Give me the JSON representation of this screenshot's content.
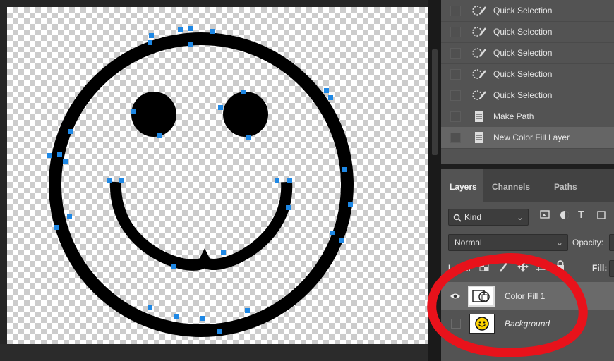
{
  "history": {
    "items": [
      {
        "label": "Quick Selection",
        "icon": "quick-selection-brush-icon",
        "selected": false
      },
      {
        "label": "Quick Selection",
        "icon": "quick-selection-brush-icon",
        "selected": false
      },
      {
        "label": "Quick Selection",
        "icon": "quick-selection-brush-icon",
        "selected": false
      },
      {
        "label": "Quick Selection",
        "icon": "quick-selection-brush-icon",
        "selected": false
      },
      {
        "label": "Quick Selection",
        "icon": "quick-selection-brush-icon",
        "selected": false
      },
      {
        "label": "Make Path",
        "icon": "document-icon",
        "selected": false
      },
      {
        "label": "New Color Fill Layer",
        "icon": "document-icon",
        "selected": true
      }
    ]
  },
  "layers_panel": {
    "tabs": [
      {
        "label": "Layers",
        "active": true
      },
      {
        "label": "Channels",
        "active": false
      },
      {
        "label": "Paths",
        "active": false
      }
    ],
    "filter": {
      "value": "Kind",
      "icon": "search-icon"
    },
    "filter_icons": [
      "image-filter-icon",
      "adjustment-filter-icon",
      "type-filter-icon",
      "shape-filter-icon"
    ],
    "blend_mode": "Normal",
    "opacity_label": "Opacity:",
    "lock_label": "Lock:",
    "fill_label": "Fill:",
    "layers": [
      {
        "name": "Color Fill 1",
        "visible": true,
        "selected": true,
        "italic": false,
        "thumb": "color-fill-thumbnail"
      },
      {
        "name": "Background",
        "visible": false,
        "selected": false,
        "italic": true,
        "thumb": "smiley-thumbnail"
      }
    ]
  },
  "colors": {
    "canvas_path": "#000000",
    "path_anchor": "#1e88e5",
    "annotation": "#e8121b",
    "panel_bg": "#535353",
    "selected_row": "#6a6a6a"
  }
}
